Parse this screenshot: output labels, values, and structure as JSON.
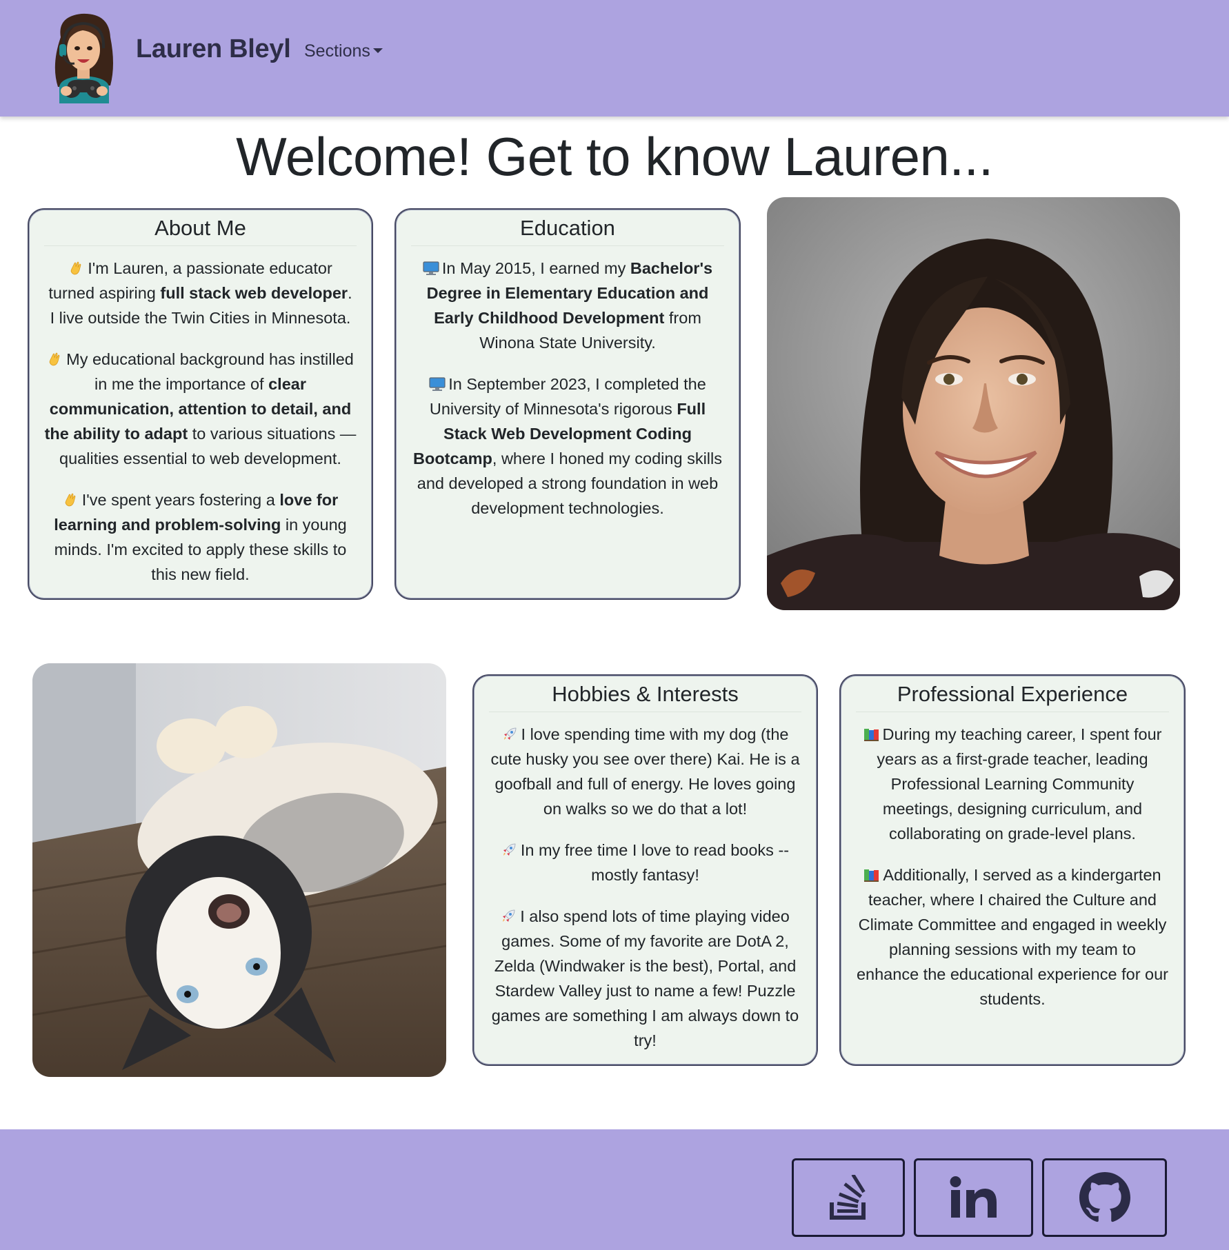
{
  "navbar": {
    "brand": "Lauren Bleyl",
    "sections_label": "Sections",
    "bg_color": "#ada3e0"
  },
  "page": {
    "title": "Welcome! Get to know Lauren..."
  },
  "about": {
    "title": "About Me",
    "p1_pre": "I'm Lauren, a passionate educator turned aspiring ",
    "p1_bold": "full stack web developer",
    "p1_post": ". I live outside the Twin Cities in Minnesota.",
    "p2_pre": "My educational background has instilled in me the importance of ",
    "p2_bold": "clear communication, attention to detail, and the ability to adapt",
    "p2_post": " to various situations — qualities essential to web development.",
    "p3_pre": "I've spent years fostering a ",
    "p3_bold": "love for learning and problem-solving",
    "p3_post": " in young minds. I'm excited to apply these skills to this new field.",
    "emoji_icon": "waving-hand-icon"
  },
  "education": {
    "title": "Education",
    "p1_pre": "In May 2015, I earned my ",
    "p1_bold": "Bachelor's Degree in Elementary Education and Early Childhood Development",
    "p1_post": " from Winona State University.",
    "p2_pre": "In September 2023, I completed the University of Minnesota's rigorous ",
    "p2_bold": "Full Stack Web Development Coding Bootcamp",
    "p2_post": ", where I honed my coding skills and developed a strong foundation in web development technologies.",
    "emoji_icon": "computer-icon"
  },
  "hobbies": {
    "title": "Hobbies & Interests",
    "p1": "I love spending time with my dog (the cute husky you see over there) Kai. He is a goofball and full of energy. He loves going on walks so we do that a lot!",
    "p2": "In my free time I love to read books -- mostly fantasy!",
    "p3": "I also spend lots of time playing video games. Some of my favorite are DotA 2, Zelda (Windwaker is the best), Portal, and Stardew Valley just to name a few! Puzzle games are something I am always down to try!",
    "emoji_icon": "rocket-icon"
  },
  "experience": {
    "title": "Professional Experience",
    "p1": "During my teaching career, I spent four years as a first-grade teacher, leading Professional Learning Community meetings, designing curriculum, and collaborating on grade-level plans.",
    "p2": "Additionally, I served as a kindergarten teacher, where I chaired the Culture and Climate Committee and engaged in weekly planning sessions with my team to enhance the educational experience for our students.",
    "emoji_icon": "books-icon"
  },
  "footer": {
    "links": [
      "stack-overflow-icon",
      "linkedin-icon",
      "github-icon"
    ],
    "icon_color": "#2b2b47"
  },
  "colors": {
    "card_bg": "#eef4ee",
    "card_border": "#474a63",
    "accent": "#ada3e0"
  }
}
